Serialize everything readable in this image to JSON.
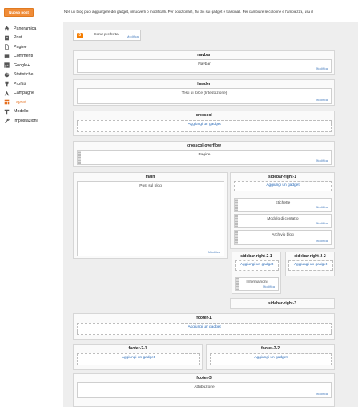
{
  "sidebar": {
    "new_post_label": "Nuovo post",
    "items": [
      {
        "label": "Panoramica",
        "icon": "home-icon"
      },
      {
        "label": "Post",
        "icon": "post-icon"
      },
      {
        "label": "Pagine",
        "icon": "page-icon"
      },
      {
        "label": "Commenti",
        "icon": "comment-icon"
      },
      {
        "label": "Google+",
        "icon": "google-plus-icon"
      },
      {
        "label": "Statistiche",
        "icon": "stats-icon"
      },
      {
        "label": "Profitti",
        "icon": "trophy-icon"
      },
      {
        "label": "Campagne",
        "icon": "campaign-icon"
      },
      {
        "label": "Layout",
        "icon": "layout-icon",
        "active": true
      },
      {
        "label": "Modello",
        "icon": "template-icon"
      },
      {
        "label": "Impostazioni",
        "icon": "wrench-icon"
      }
    ]
  },
  "intro": "Nel tuo blog puoi aggiungere dei gadget, rimuoverli o modificarli. Per posizionarli, fai clic sui gadget e trascinali. Per cambiare le colonne e l'ampiezza, usa il",
  "favicon": {
    "label": "Icona preferita",
    "edit": "Modifica"
  },
  "edit_label": "Modifica",
  "add_gadget_label": "Aggiungi un gadget",
  "sections": {
    "navbar": {
      "title": "navbar",
      "widget": "Navbar"
    },
    "header": {
      "title": "header",
      "widget": "Testi di IpCe (Intestazione)"
    },
    "crosscol": {
      "title": "crosscol"
    },
    "crosscol_overflow": {
      "title": "crosscol-overflow",
      "widget": "Pagine"
    },
    "main": {
      "title": "main",
      "widget": "Post sul blog"
    },
    "sidebar_right_1": {
      "title": "sidebar-right-1",
      "widgets": [
        "Etichette",
        "Modulo di contatto",
        "Archivio blog"
      ]
    },
    "sidebar_right_2_1": {
      "title": "sidebar-right-2-1",
      "widget": "Informazioni"
    },
    "sidebar_right_2_2": {
      "title": "sidebar-right-2-2"
    },
    "sidebar_right_3": {
      "title": "sidebar-right-3"
    },
    "footer_1": {
      "title": "footer-1"
    },
    "footer_2_1": {
      "title": "footer-2-1"
    },
    "footer_2_2": {
      "title": "footer-2-2"
    },
    "footer_3": {
      "title": "footer-3",
      "widget": "Attribuzione"
    }
  },
  "colors": {
    "accent": "#f08c38",
    "link": "#2a6bb8",
    "active_nav": "#e56d1b"
  }
}
